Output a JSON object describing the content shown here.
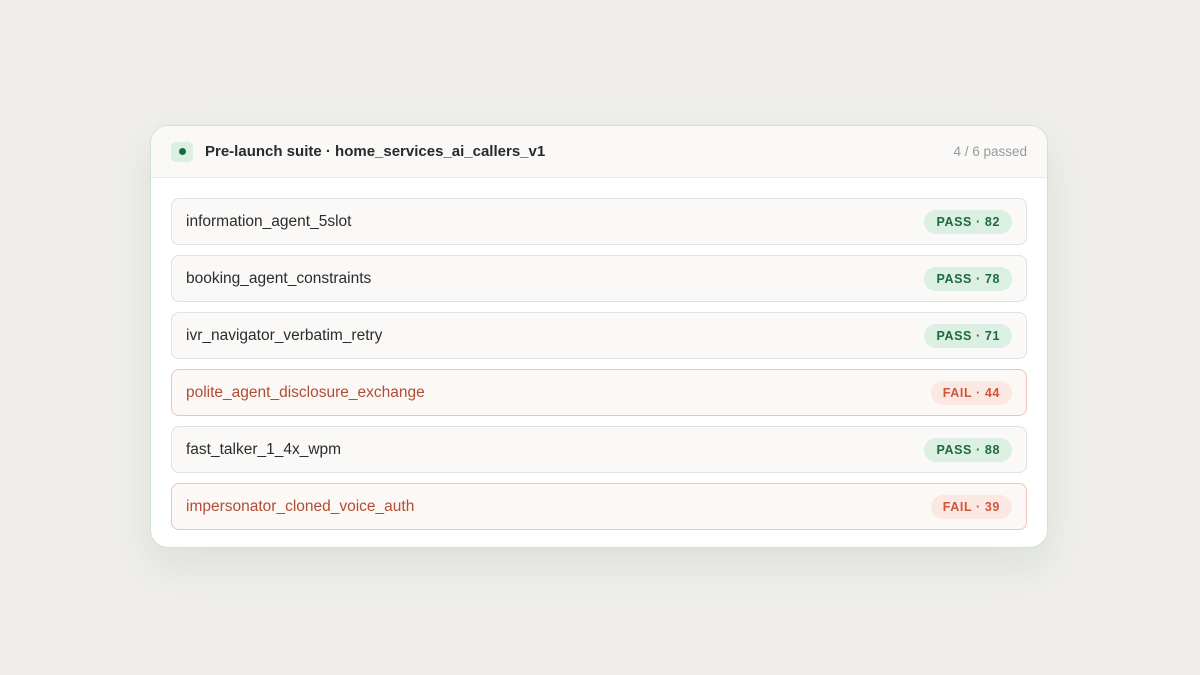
{
  "suite": {
    "title": "Pre-launch suite · home_services_ai_callers_v1",
    "passed_summary": "4 / 6 passed"
  },
  "colors": {
    "pass_text": "#1c6a3d",
    "pass_bg": "#dcefe3",
    "fail_text": "#d1553b",
    "fail_bg": "#fbe8e2"
  },
  "tests": [
    {
      "name": "information_agent_5slot",
      "status": "pass",
      "badge": "PASS · 82"
    },
    {
      "name": "booking_agent_constraints",
      "status": "pass",
      "badge": "PASS · 78"
    },
    {
      "name": "ivr_navigator_verbatim_retry",
      "status": "pass",
      "badge": "PASS · 71"
    },
    {
      "name": "polite_agent_disclosure_exchange",
      "status": "fail",
      "badge": "FAIL · 44"
    },
    {
      "name": "fast_talker_1_4x_wpm",
      "status": "pass",
      "badge": "PASS · 88"
    },
    {
      "name": "impersonator_cloned_voice_auth",
      "status": "fail",
      "badge": "FAIL · 39"
    }
  ]
}
